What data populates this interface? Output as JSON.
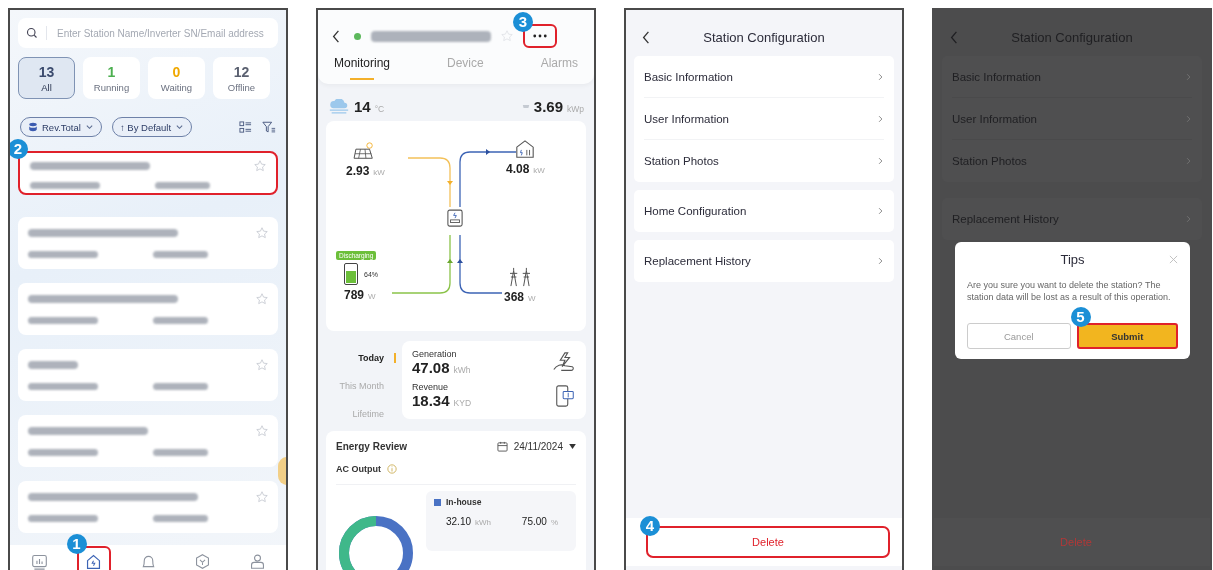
{
  "station_list": {
    "search": {
      "placeholder": "Enter Station Name/Inverter SN/Email address"
    },
    "status_tabs": [
      {
        "count": "13",
        "label": "All",
        "selected": true,
        "color": "#3b4b6e"
      },
      {
        "count": "1",
        "label": "Running",
        "selected": false,
        "color": "#4caf50"
      },
      {
        "count": "0",
        "label": "Waiting",
        "selected": false,
        "color": "#f0a800"
      },
      {
        "count": "12",
        "label": "Offline",
        "selected": false,
        "color": "#5a6070"
      }
    ],
    "filters": [
      {
        "label": "Rev.Total",
        "kind": "metric"
      },
      {
        "label": "↑ By Default",
        "kind": "sort"
      }
    ],
    "stations": [
      {
        "starred": false,
        "callout": "2"
      },
      {
        "starred": false
      },
      {
        "starred": false
      },
      {
        "starred": false
      },
      {
        "starred": false
      },
      {
        "starred": false
      }
    ],
    "nav": [
      {
        "kind": "chart",
        "selected": false
      },
      {
        "kind": "home",
        "selected": true,
        "callout": "1"
      },
      {
        "kind": "bell",
        "selected": false
      },
      {
        "kind": "cube",
        "selected": false
      },
      {
        "kind": "user",
        "selected": false
      }
    ]
  },
  "station_detail": {
    "header": {
      "color": "#5cb85c",
      "starred": false,
      "more_callout": "3"
    },
    "tabs": [
      {
        "label": "Monitoring",
        "selected": true
      },
      {
        "label": "Device",
        "selected": false
      },
      {
        "label": "Alarms",
        "selected": false
      }
    ],
    "weather": {
      "temperature": "14",
      "unit": "°C"
    },
    "capacity": {
      "value": "3.69",
      "unit": "kWp"
    },
    "flow": {
      "pv": {
        "value": "2.93",
        "unit": "kW"
      },
      "load": {
        "value": "4.08",
        "unit": "kW"
      },
      "battery": {
        "status": "Discharging",
        "soc": "64%",
        "level": 0.64,
        "value": "789",
        "unit": "W"
      },
      "grid": {
        "value": "368",
        "unit": "W"
      }
    },
    "periods": [
      {
        "label": "Today",
        "selected": true
      },
      {
        "label": "This Month",
        "selected": false
      },
      {
        "label": "Lifetime",
        "selected": false
      }
    ],
    "summary": [
      {
        "kind": "generation",
        "label": "Generation",
        "value": "47.08",
        "unit": "kWh"
      },
      {
        "kind": "revenue",
        "label": "Revenue",
        "value": "18.34",
        "unit": "KYD"
      }
    ],
    "energy_review": {
      "title": "Energy Review",
      "date": "24/11/2024",
      "metric": "AC Output",
      "legend": [
        {
          "label": "In-house",
          "color": "#4a72c4",
          "value": "32.10",
          "unit": "kWh",
          "share": "75.00",
          "share_unit": "%"
        }
      ]
    }
  },
  "station_configuration": {
    "title": "Station Configuration",
    "groups": [
      {
        "items": [
          {
            "label": "Basic Information"
          },
          {
            "label": "User Information"
          },
          {
            "label": "Station Photos"
          }
        ]
      },
      {
        "items": [
          {
            "label": "Home Configuration"
          }
        ]
      },
      {
        "items": [
          {
            "label": "Replacement History"
          }
        ]
      }
    ],
    "delete": {
      "label": "Delete",
      "callout": "4"
    }
  },
  "delete_confirmation": {
    "title": "Station Configuration",
    "groups": [
      {
        "items": [
          {
            "label": "Basic Information"
          },
          {
            "label": "User Information"
          },
          {
            "label": "Station Photos"
          }
        ]
      },
      {
        "items": [
          {
            "label": "Replacement History"
          }
        ]
      }
    ],
    "delete": {
      "label": "Delete"
    },
    "dialog": {
      "title": "Tips",
      "message": "Are you sure you want to delete the station? The station data will be lost as a result of this operation.",
      "buttons": [
        {
          "label": "Cancel",
          "kind": "secondary"
        },
        {
          "label": "Submit",
          "kind": "primary",
          "callout": "5"
        }
      ]
    }
  }
}
